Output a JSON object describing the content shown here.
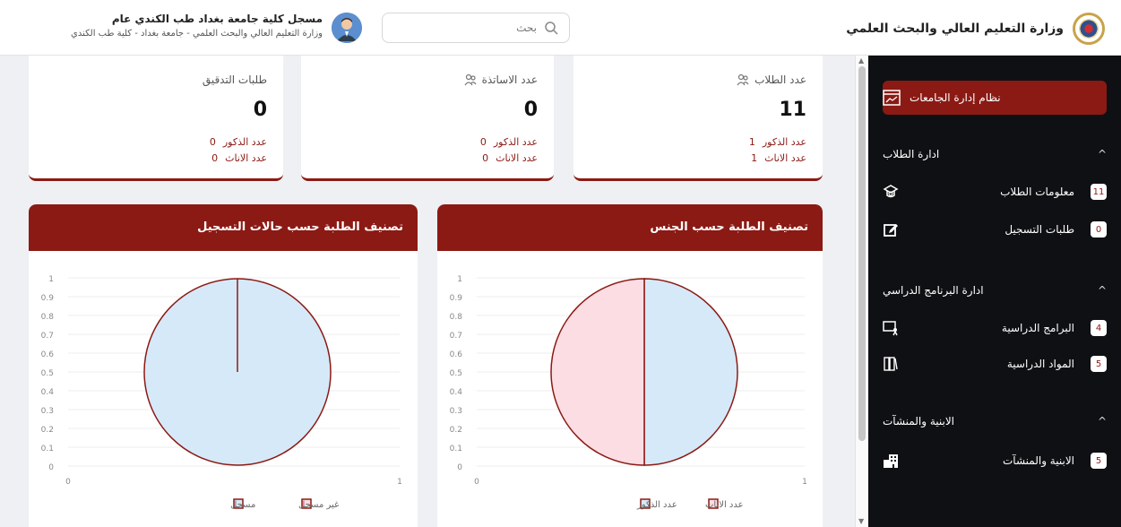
{
  "header": {
    "brand_title": "وزارة التعليم العالي والبحث العلمي",
    "search_placeholder": "بحث",
    "user_name": "مسجل كلية جامعة بغداد طب الكندي عام",
    "user_subtitle": "وزارة التعليم العالي والبحث العلمي - جامعة بغداد - كلية طب الكندي"
  },
  "sidebar": {
    "active_item": {
      "label": "نظام إدارة الجامعات",
      "icon": "chart-window-icon"
    },
    "sections": [
      {
        "title": "ادارة الطلاب",
        "items": [
          {
            "label": "معلومات الطلاب",
            "badge": "11",
            "icon": "student-icon"
          },
          {
            "label": "طلبات التسجيل",
            "badge": "0",
            "icon": "edit-icon"
          }
        ]
      },
      {
        "title": "ادارة البرنامج الدراسي",
        "items": [
          {
            "label": "البرامج الدراسية",
            "badge": "4",
            "icon": "presentation-icon"
          },
          {
            "label": "المواد الدراسية",
            "badge": "5",
            "icon": "books-icon"
          }
        ]
      },
      {
        "title": "الابنية والمنشآت",
        "items": [
          {
            "label": "الابنية والمنشآت",
            "badge": "5",
            "icon": "building-icon"
          }
        ]
      }
    ]
  },
  "cards": [
    {
      "title": "عدد الطلاب",
      "value": "11",
      "males_label": "عدد الذكور",
      "males": "1",
      "females_label": "عدد الاناث",
      "females": "1"
    },
    {
      "title": "عدد الاساتذة",
      "value": "0",
      "males_label": "عدد الذكور",
      "males": "0",
      "females_label": "عدد الاناث",
      "females": "0"
    },
    {
      "title": "طلبات التدقيق",
      "value": "0",
      "males_label": "عدد الذكور",
      "males": "0",
      "females_label": "عدد الاناث",
      "females": "0"
    }
  ],
  "colors": {
    "accent": "#8b1a14",
    "sidebar_bg": "#0f1013",
    "pie_blue": "#d6e9f8",
    "pie_pink": "#fbdde3"
  },
  "chart_data": [
    {
      "type": "pie",
      "title": "تصنيف الطلبة حسب الجنس",
      "y_ticks": [
        "1",
        "0.9",
        "0.8",
        "0.7",
        "0.6",
        "0.5",
        "0.4",
        "0.3",
        "0.2",
        "0.1",
        "0"
      ],
      "x_ticks": [
        "0",
        "1"
      ],
      "categories": [
        "عدد الاناث",
        "عدد الذكور"
      ],
      "values": [
        1,
        1
      ],
      "colors": [
        "#fbdde3",
        "#d6e9f8"
      ],
      "legend_position": "bottom"
    },
    {
      "type": "pie",
      "title": "تصنيف الطلبة حسب حالات التسجيل",
      "y_ticks": [
        "1",
        "0.9",
        "0.8",
        "0.7",
        "0.6",
        "0.5",
        "0.4",
        "0.3",
        "0.2",
        "0.1",
        "0"
      ],
      "x_ticks": [
        "0",
        "1"
      ],
      "categories": [
        "غير مسجل",
        "مسجل"
      ],
      "values": [
        0,
        1
      ],
      "colors": [
        "#fbdde3",
        "#d6e9f8"
      ],
      "legend_position": "bottom"
    }
  ]
}
